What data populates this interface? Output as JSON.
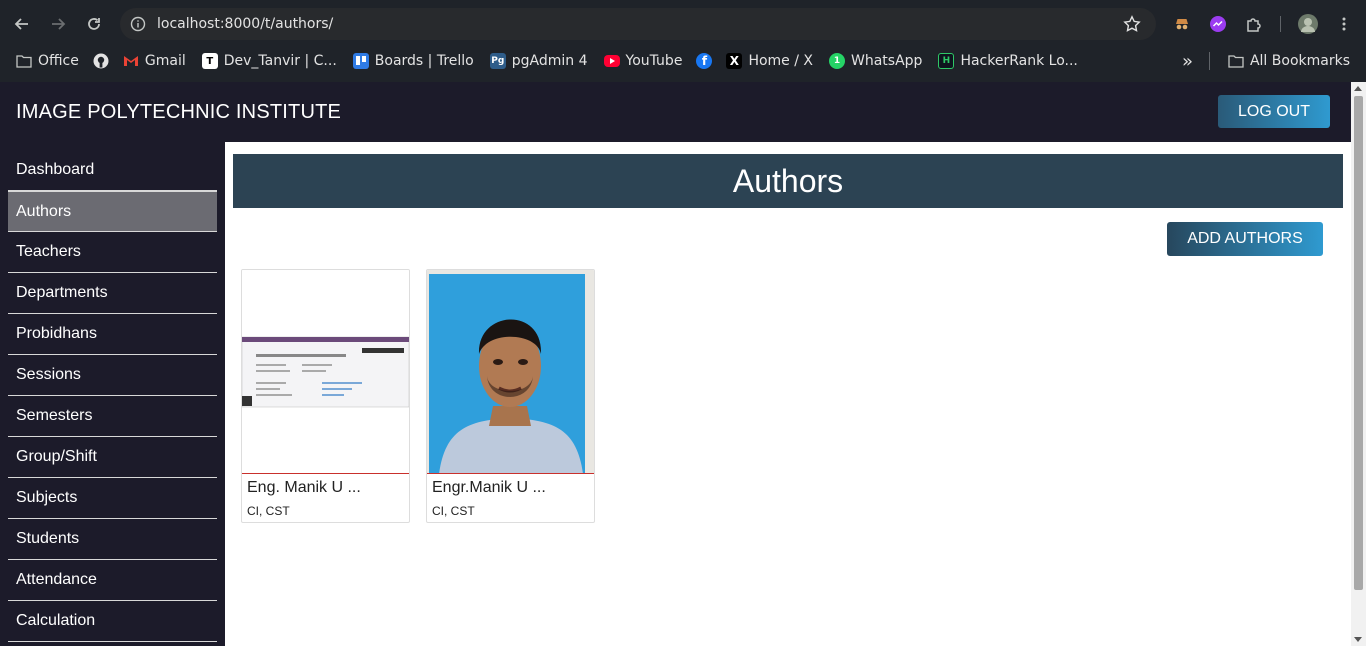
{
  "browser": {
    "url": "localhost:8000/t/authors/",
    "bookmarks": [
      {
        "label": "Office",
        "icon": "folder-icon"
      },
      {
        "label": "",
        "icon": "github-icon"
      },
      {
        "label": "Gmail",
        "icon": "gmail-icon"
      },
      {
        "label": "Dev_Tanvir | C...",
        "icon": "dev-icon"
      },
      {
        "label": "Boards | Trello",
        "icon": "trello-icon"
      },
      {
        "label": "pgAdmin 4",
        "icon": "pgadmin-icon"
      },
      {
        "label": "YouTube",
        "icon": "youtube-icon"
      },
      {
        "label": "",
        "icon": "facebook-icon"
      },
      {
        "label": "Home / X",
        "icon": "x-icon"
      },
      {
        "label": "WhatsApp",
        "icon": "whatsapp-icon"
      },
      {
        "label": "HackerRank Lo...",
        "icon": "hackerrank-icon"
      }
    ],
    "all_bookmarks": "All Bookmarks",
    "more_bookmarks": "»"
  },
  "header": {
    "brand": "IMAGE POLYTECHNIC INSTITUTE",
    "logout_label": "LOG OUT"
  },
  "sidebar": {
    "items": [
      {
        "label": "Dashboard",
        "active": false
      },
      {
        "label": "Authors",
        "active": true
      },
      {
        "label": "Teachers",
        "active": false
      },
      {
        "label": "Departments",
        "active": false
      },
      {
        "label": "Probidhans",
        "active": false
      },
      {
        "label": "Sessions",
        "active": false
      },
      {
        "label": "Semesters",
        "active": false
      },
      {
        "label": "Group/Shift",
        "active": false
      },
      {
        "label": "Subjects",
        "active": false
      },
      {
        "label": "Students",
        "active": false
      },
      {
        "label": "Attendance",
        "active": false
      },
      {
        "label": "Calculation",
        "active": false
      }
    ]
  },
  "main": {
    "title": "Authors",
    "add_label": "ADD AUTHORS",
    "authors": [
      {
        "name": "Eng. Manik U ...",
        "role": "CI, CST"
      },
      {
        "name": "Engr.Manik U ...",
        "role": "CI, CST"
      }
    ]
  },
  "colors": {
    "header_bg": "#1c1b2a",
    "banner_bg": "#2c4353",
    "accent": "#2f9ad0",
    "card_divider": "#c9302c"
  }
}
